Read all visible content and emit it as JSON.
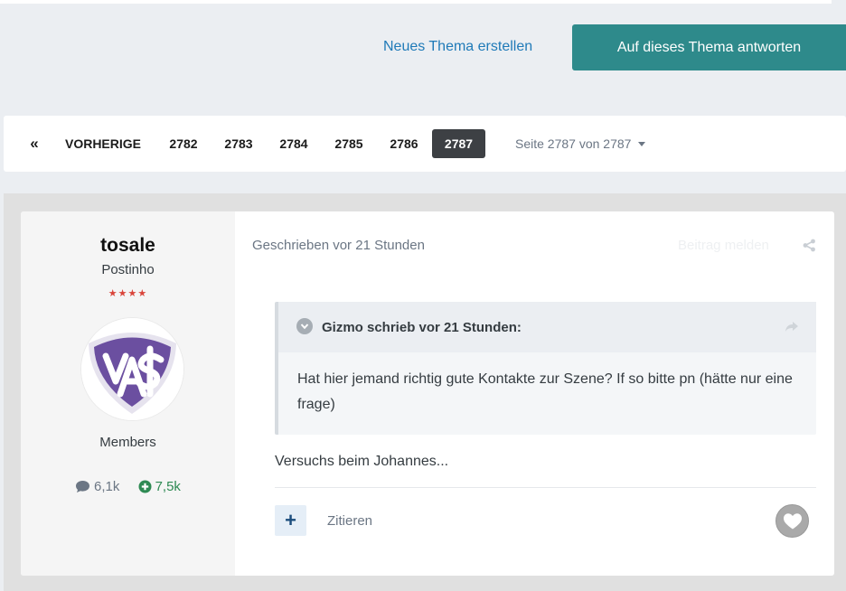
{
  "actions": {
    "new_topic": "Neues Thema erstellen",
    "reply": "Auf dieses Thema antworten"
  },
  "pagination": {
    "first_icon": "«",
    "prev": "VORHERIGE",
    "pages": [
      "2782",
      "2783",
      "2784",
      "2785",
      "2786",
      "2787"
    ],
    "active": "2787",
    "page_label": "Seite 2787 von 2787"
  },
  "author": {
    "name": "tosale",
    "title": "Postinho",
    "stars": "★★★★",
    "group": "Members",
    "posts": "6,1k",
    "reputation": "7,5k",
    "avatar_icon": "club-crest-icon"
  },
  "post": {
    "meta": "Geschrieben vor 21 Stunden",
    "report": "Beitrag melden",
    "quote": {
      "citation": "Gizmo schrieb vor 21 Stunden:",
      "text": "Hat hier jemand richtig gute Kontakte zur Szene? If so bitte pn (hätte nur eine frage)"
    },
    "text": "Versuchs beim Johannes...",
    "multiquote": "+",
    "quote_label": "Zitieren"
  },
  "colors": {
    "accent": "#2e8a8b",
    "link": "#1f7ab8",
    "reputation": "#2e8a53",
    "stars": "#d9453b",
    "crest_purple": "#6b4fa0"
  }
}
